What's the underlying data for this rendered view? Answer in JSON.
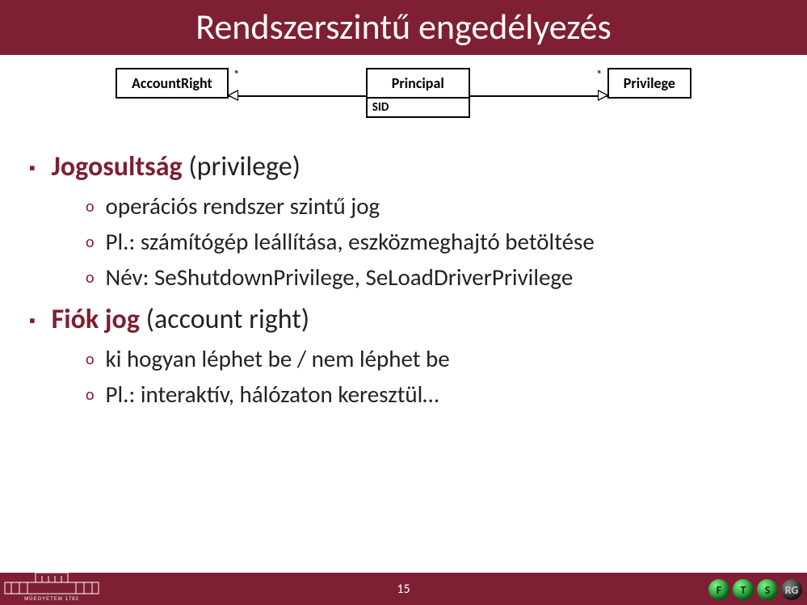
{
  "title": "Rendszerszintű engedélyezés",
  "diagram": {
    "left_box": "AccountRight",
    "center_box": "Principal",
    "center_attr": "SID",
    "right_box": "Privilege",
    "mult_left": "*",
    "mult_right": "*"
  },
  "bullets": [
    {
      "strong": "Jogosultság",
      "rest": " (privilege)",
      "subs": [
        "operációs rendszer szintű jog",
        "Pl.: számítógép leállítása, eszközmeghajtó betöltése",
        "Név: SeShutdownPrivilege, SeLoadDriverPrivilege"
      ]
    },
    {
      "strong": "Fiók jog",
      "rest": " (account right)",
      "subs": [
        "ki hogyan léphet be / nem léphet be",
        "Pl.: interaktív, hálózaton keresztül…"
      ]
    }
  ],
  "page_number": "15",
  "footer_left_label": "MŰEGYETEM 1782",
  "footer_right_letters": [
    "F",
    "T",
    "S",
    "RG"
  ]
}
